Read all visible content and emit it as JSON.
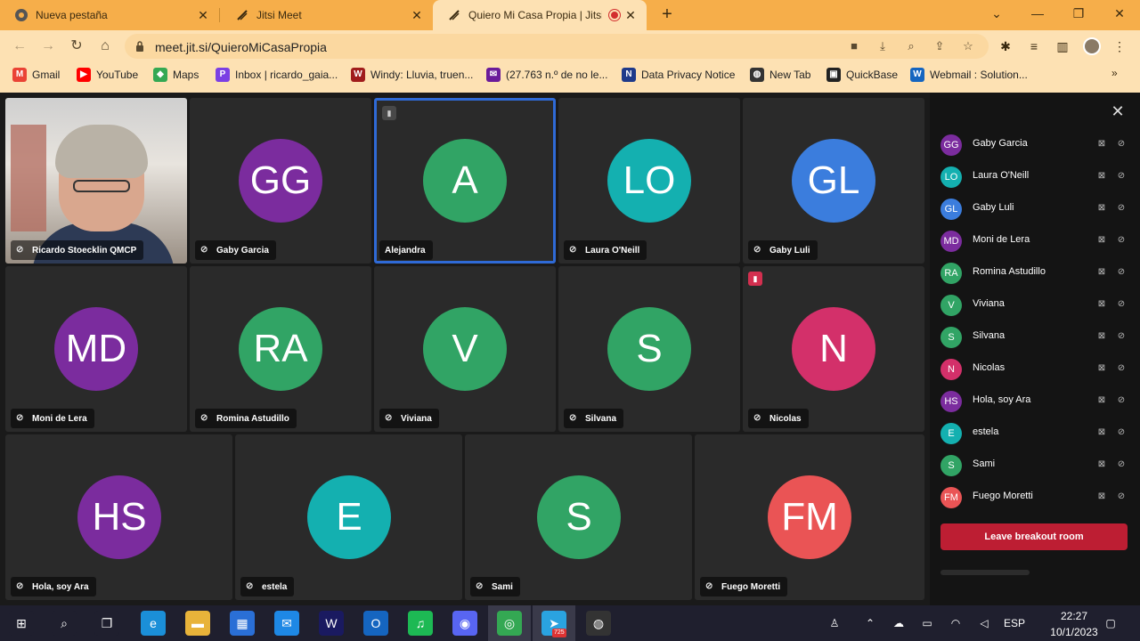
{
  "browser": {
    "tabs": [
      {
        "title": "Nueva pestaña",
        "icon": "chrome-icon"
      },
      {
        "title": "Jitsi Meet",
        "icon": "jitsi-icon"
      },
      {
        "title": "Quiero Mi Casa Propia | Jitsi",
        "icon": "jitsi-icon",
        "recording": true
      }
    ],
    "new_tab": "+",
    "url": "meet.jit.si/QuieroMiCasaPropia",
    "bookmarks": [
      {
        "label": "Gmail",
        "icon": "gmail-icon",
        "color": "#ea4335",
        "glyph": "M"
      },
      {
        "label": "YouTube",
        "icon": "youtube-icon",
        "color": "#ff0000",
        "glyph": "▶"
      },
      {
        "label": "Maps",
        "icon": "maps-icon",
        "color": "#34a853",
        "glyph": "◆"
      },
      {
        "label": "Inbox | ricardo_gaia...",
        "icon": "inbox-icon",
        "color": "#7b3fe4",
        "glyph": "P"
      },
      {
        "label": "Windy: Lluvia, truen...",
        "icon": "windy-icon",
        "color": "#a01c1c",
        "glyph": "W"
      },
      {
        "label": "(27.763 n.º de no le...",
        "icon": "mail-icon",
        "color": "#6a1b9a",
        "glyph": "✉"
      },
      {
        "label": "Data Privacy Notice",
        "icon": "notion-icon",
        "color": "#1e3a8a",
        "glyph": "N"
      },
      {
        "label": "New Tab",
        "icon": "globe-icon",
        "color": "#333333",
        "glyph": "◍"
      },
      {
        "label": "QuickBase",
        "icon": "quickbase-icon",
        "color": "#222222",
        "glyph": "▣"
      },
      {
        "label": "Webmail : Solution...",
        "icon": "webmail-icon",
        "color": "#1565c0",
        "glyph": "W"
      }
    ],
    "bookmarks_more": "»"
  },
  "meeting": {
    "tiles": [
      {
        "name": "Ricardo Stoecklin QMCP",
        "video": true
      },
      {
        "name": "Gaby Garcia",
        "initials": "GG",
        "color": "#7b2c9e"
      },
      {
        "name": "Alejandra",
        "initials": "A",
        "color": "#31a465",
        "speaking": true,
        "conn": true
      },
      {
        "name": "Laura O'Neill",
        "initials": "LO",
        "color": "#14b0b0"
      },
      {
        "name": "Gaby Luli",
        "initials": "GL",
        "color": "#3b7ddd"
      },
      {
        "name": "Moni de Lera",
        "initials": "MD",
        "color": "#7b2c9e"
      },
      {
        "name": "Romina Astudillo",
        "initials": "RA",
        "color": "#31a465"
      },
      {
        "name": "Viviana",
        "initials": "V",
        "color": "#31a465"
      },
      {
        "name": "Silvana",
        "initials": "S",
        "color": "#31a465"
      },
      {
        "name": "Nicolas",
        "initials": "N",
        "color": "#d3306a",
        "conn_bad": true
      },
      {
        "name": "Hola, soy Ara",
        "initials": "HS",
        "color": "#7b2c9e"
      },
      {
        "name": "estela",
        "initials": "E",
        "color": "#14b0b0"
      },
      {
        "name": "Sami",
        "initials": "S",
        "color": "#31a465"
      },
      {
        "name": "Fuego Moretti",
        "initials": "FM",
        "color": "#ea5455"
      }
    ]
  },
  "participants": {
    "list": [
      {
        "name": "Gaby Garcia",
        "initials": "GG",
        "color": "#7b2c9e"
      },
      {
        "name": "Laura O'Neill",
        "initials": "LO",
        "color": "#14b0b0"
      },
      {
        "name": "Gaby Luli",
        "initials": "GL",
        "color": "#3b7ddd"
      },
      {
        "name": "Moni de Lera",
        "initials": "MD",
        "color": "#7b2c9e"
      },
      {
        "name": "Romina Astudillo",
        "initials": "RA",
        "color": "#31a465"
      },
      {
        "name": "Viviana",
        "initials": "V",
        "color": "#31a465"
      },
      {
        "name": "Silvana",
        "initials": "S",
        "color": "#31a465"
      },
      {
        "name": "Nicolas",
        "initials": "N",
        "color": "#d3306a"
      },
      {
        "name": "Hola, soy Ara",
        "initials": "HS",
        "color": "#7b2c9e"
      },
      {
        "name": "estela",
        "initials": "E",
        "color": "#14b0b0"
      },
      {
        "name": "Sami",
        "initials": "S",
        "color": "#31a465"
      },
      {
        "name": "Fuego Moretti",
        "initials": "FM",
        "color": "#ea5455"
      }
    ],
    "leave_label": "Leave breakout room"
  },
  "taskbar": {
    "apps": [
      {
        "icon": "windows-start-icon",
        "glyph": "⊞",
        "color": "#1f1f2e"
      },
      {
        "icon": "search-icon",
        "glyph": "⌕",
        "color": "#1f1f2e"
      },
      {
        "icon": "task-view-icon",
        "glyph": "❐",
        "color": "#1f1f2e"
      },
      {
        "icon": "edge-icon",
        "glyph": "e",
        "color": "#1b8fd8"
      },
      {
        "icon": "file-explorer-icon",
        "glyph": "▬",
        "color": "#e8b33a"
      },
      {
        "icon": "store-icon",
        "glyph": "▦",
        "color": "#2a6fd6"
      },
      {
        "icon": "mail-app-icon",
        "glyph": "✉",
        "color": "#1e88e5"
      },
      {
        "icon": "webex-icon",
        "glyph": "W",
        "color": "#1a1a60"
      },
      {
        "icon": "outlook-icon",
        "glyph": "O",
        "color": "#1565c0"
      },
      {
        "icon": "spotify-icon",
        "glyph": "♫",
        "color": "#1db954"
      },
      {
        "icon": "discord-icon",
        "glyph": "◉",
        "color": "#5865f2"
      },
      {
        "icon": "chrome-icon",
        "glyph": "◎",
        "color": "#34a853"
      },
      {
        "icon": "telegram-icon",
        "glyph": "➤",
        "color": "#2aa3e0"
      },
      {
        "icon": "obs-icon",
        "glyph": "◍",
        "color": "#333333"
      }
    ],
    "telegram_badge": "725",
    "language": "ESP",
    "time": "22:27",
    "date": "10/1/2023"
  }
}
